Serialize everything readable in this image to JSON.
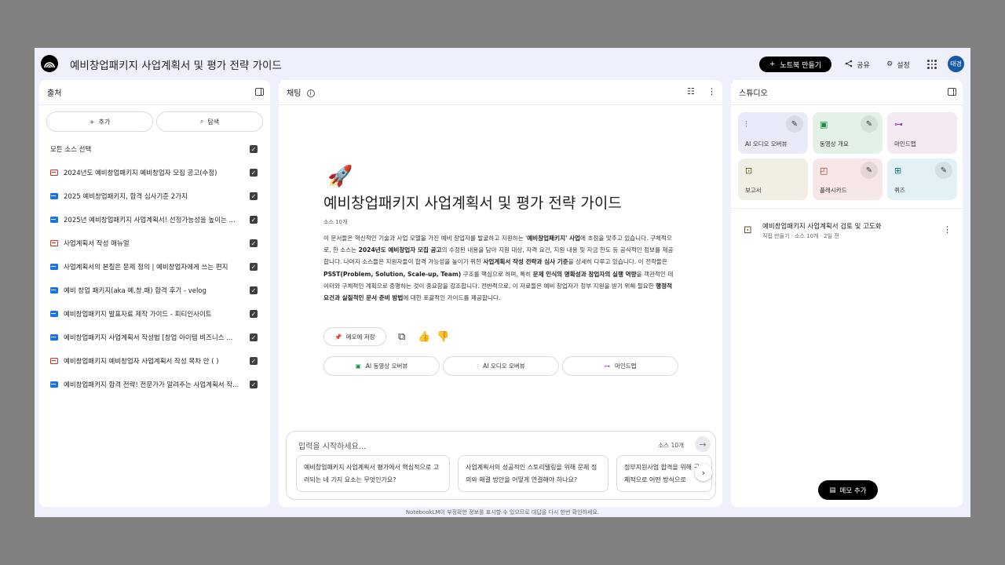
{
  "header": {
    "title": "예비창업패키지 사업계획서 및 평가 전략 가이드",
    "new_notebook": "노트북 만들기",
    "share": "공유",
    "settings": "설정",
    "avatar": "태경"
  },
  "sources": {
    "title": "출처",
    "add": "추가",
    "explore": "탐색",
    "select_all": "모든 소스 선택",
    "items": [
      {
        "label": "2024년도 예비창업패키지 예비창업자 모집 공고(수정)",
        "type": "pdf"
      },
      {
        "label": "2025 예비창업패키지, 합격 심사기준 2가지",
        "type": "web"
      },
      {
        "label": "2025년 예비창업패키지 사업계획서! 선정가능성을 높이는 ...",
        "type": "web"
      },
      {
        "label": "사업계획서 작성 매뉴얼",
        "type": "pdf"
      },
      {
        "label": "사업계획서의 본질은 문제 정의 | 예비창업자에게 쓰는 편지",
        "type": "web"
      },
      {
        "label": "예비 창업 패키지(aka 예.창.패) 합격 후기 - velog",
        "type": "web"
      },
      {
        "label": "예비창업패키지 발표자료 제작 가이드 - 피티인사이트",
        "type": "web"
      },
      {
        "label": "예비창업패키지 사업계획서 작성법 [창업 아이템 비즈니스 ...",
        "type": "web"
      },
      {
        "label": "예비창업패키지 예비창업자 사업계획서 작성 목차 안 ( )",
        "type": "pdf"
      },
      {
        "label": "예비창업패키지 합격 전략! 전문가가 알려주는 사업계획서 작...",
        "type": "web"
      }
    ]
  },
  "chat": {
    "title": "채팅",
    "notebook_title": "예비창업패키지 사업계획서 및 평가 전략 가이드",
    "source_count": "소스 10개",
    "summary": {
      "s1": "이 문서들은 혁신적인 기술과 사업 모델을 가진 예비 창업자를 발굴하고 지원하는 '",
      "b1": "예비창업패키지' 사업",
      "s2": "에 초점을 맞추고 있습니다. 구체적으로, 한 소스는 ",
      "b2": "2024년도 예비창업자 모집 공고",
      "s3": "의 수정된 내용을 담아 지원 대상, 자격 요건, 지원 내용 및 자금 한도 등 공식적인 정보를 제공합니다. 나머지 소스들은 지원자들이 합격 가능성을 높이기 위한 ",
      "b3": "사업계획서 작성 전략과 심사 기준",
      "s4": "을 상세히 다루고 있습니다. 이 전략들은 ",
      "b4": "PSST(Problem, Solution, Scale-up, Team)",
      "s5": " 구조를 핵심으로 하며, 특히 ",
      "b5": "문제 인식의 명확성과 창업자의 실행 역량",
      "s6": "을 객관적인 데이터와 구체적인 계획으로 증명하는 것이 중요함을 강조합니다. 전반적으로, 이 자료들은 예비 창업자가 정부 지원을 받기 위해 필요한 ",
      "b6": "행정적 요건과 실질적인 문서 준비 방법",
      "s7": "에 대한 포괄적인 가이드를 제공합니다."
    },
    "save_memo": "메모에 저장",
    "pills": [
      "AI 동영상 오버뷰",
      "AI 오디오 오버뷰",
      "마인드맵"
    ],
    "input_placeholder": "입력을 시작하세요...",
    "input_count": "소스 10개",
    "suggestions": [
      "예비창업패키지 사업계획서 평가에서 핵심적으로 고려되는 네 가지 요소는 무엇인가요?",
      "사업계획서의 성공적인 스토리텔링을 위해 문제 정의와 해결 방안을 어떻게 연결해야 하나요?",
      "정부지원사업 합격을 위해 구체적으로 어떤 방식으로"
    ]
  },
  "studio": {
    "title": "스튜디오",
    "tiles": [
      {
        "label": "AI 오디오 오버뷰",
        "color": "#e9ebf8",
        "icon": "audio-icon"
      },
      {
        "label": "동영상 개요",
        "color": "#e3f1e6",
        "icon": "video-icon"
      },
      {
        "label": "마인드맵",
        "color": "#f2e9f2",
        "icon": "mindmap-icon"
      },
      {
        "label": "보고서",
        "color": "#f1efe3",
        "icon": "report-icon"
      },
      {
        "label": "플래시카드",
        "color": "#f7e8e8",
        "icon": "flashcard-icon"
      },
      {
        "label": "퀴즈",
        "color": "#e2f1f6",
        "icon": "quiz-icon"
      }
    ],
    "note": {
      "title": "예비창업패키지 사업계획서 검토 및 고도화",
      "subtitle": "직접 만들기 · 소스 10개 · 2일 전"
    },
    "add_memo": "메모 추가"
  },
  "footer": "NotebookLM이 부정확한 정보를 표시할 수 있으므로 대답을 다시 한번 확인하세요."
}
